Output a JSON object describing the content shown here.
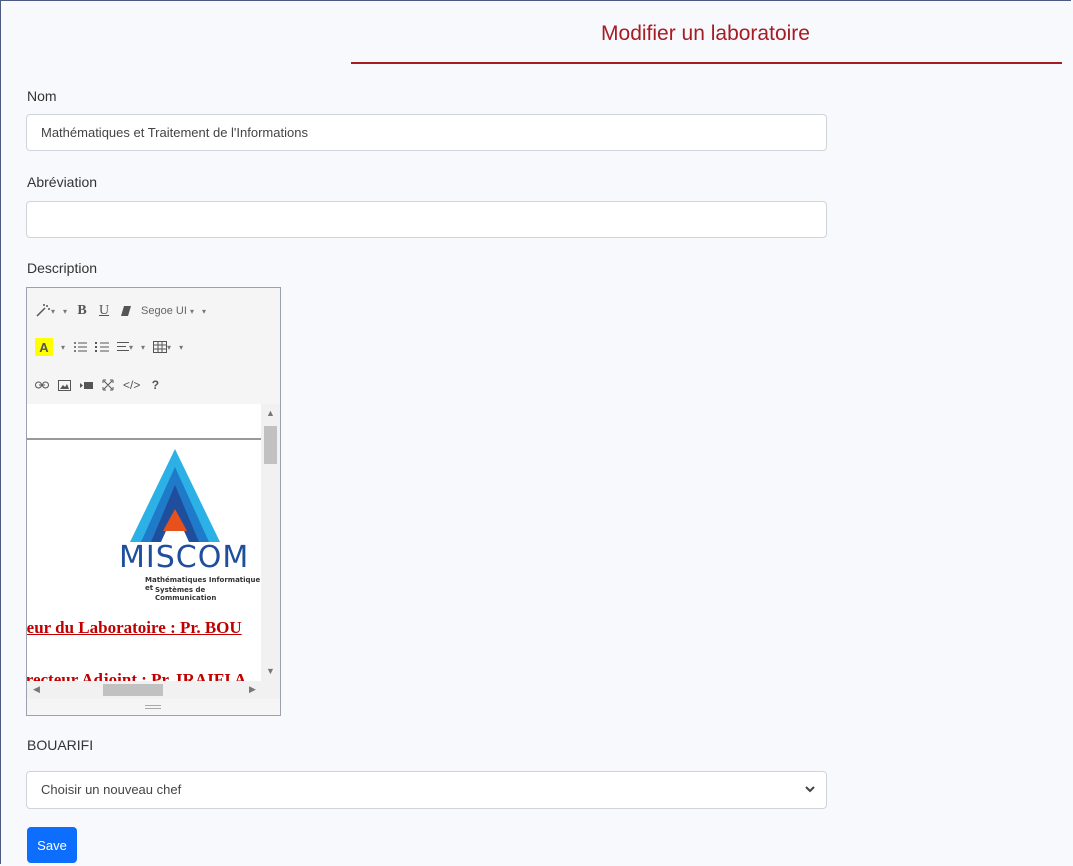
{
  "page": {
    "title": "Modifier un laboratoire"
  },
  "form": {
    "nom_label": "Nom",
    "nom_value": "Mathématiques et Traitement de l'Informations",
    "abreviation_label": "Abréviation",
    "abreviation_value": "",
    "description_label": "Description",
    "chef_label": "BOUARIFI",
    "chef_select_value": "Choisir un nouveau chef",
    "save_label": "Save"
  },
  "editor": {
    "toolbar": {
      "bold": "B",
      "underline": "U",
      "font_name": "Segoe UI",
      "code": "</>",
      "help": "?"
    },
    "content": {
      "logo_text": "MISCOM",
      "logo_subtitle_1": "Mathématiques Informatique et",
      "logo_subtitle_2": "Systèmes de Communication",
      "line_1": "teur du Laboratoire : Pr. BOU",
      "line_2": "irecteur Adjoint : Pr. IRAIFI A"
    }
  },
  "colors": {
    "accent": "#a61c23",
    "primary_button": "#0d6efd",
    "logo_blue": "#1f4e9c",
    "logo_orange": "#e8501c"
  }
}
